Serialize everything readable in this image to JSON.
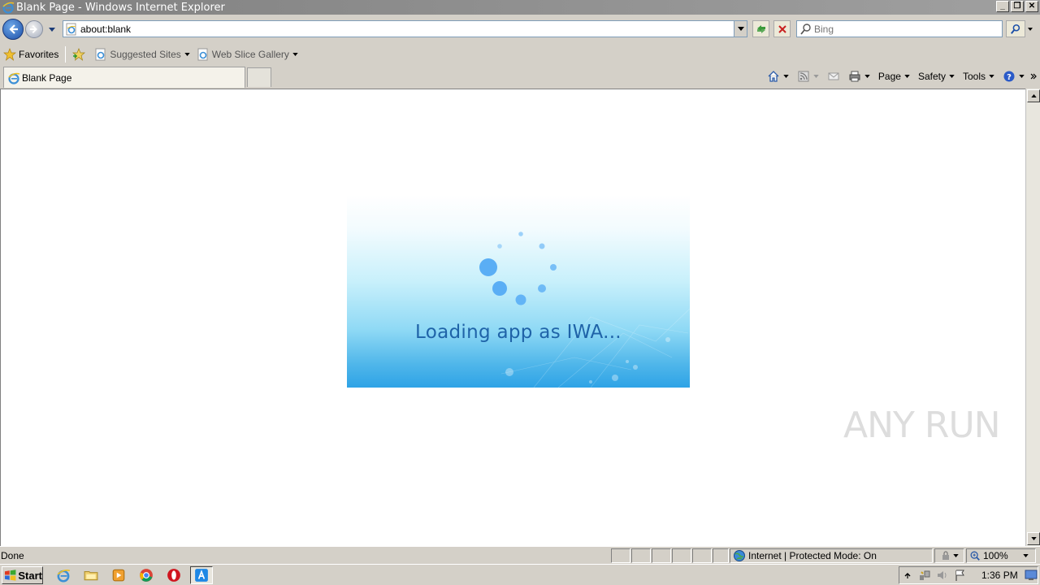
{
  "window": {
    "title": "Blank Page - Windows Internet Explorer"
  },
  "address": {
    "url": "about:blank"
  },
  "search": {
    "placeholder": "Bing"
  },
  "favorites": {
    "label": "Favorites",
    "items": [
      {
        "label": "Suggested Sites"
      },
      {
        "label": "Web Slice Gallery"
      }
    ]
  },
  "tabs": [
    {
      "label": "Blank Page"
    }
  ],
  "commands": {
    "page": "Page",
    "safety": "Safety",
    "tools": "Tools"
  },
  "content": {
    "loading_text": "Loading app as IWA...",
    "watermark": "ANY RUN"
  },
  "status": {
    "text": "Done",
    "zone": "Internet | Protected Mode: On",
    "zoom": "100%"
  },
  "taskbar": {
    "start_label": "Start",
    "clock": "1:36 PM"
  },
  "colors": {
    "loading_text": "#1f63a8",
    "spinner_dot": "#5aaef5"
  }
}
